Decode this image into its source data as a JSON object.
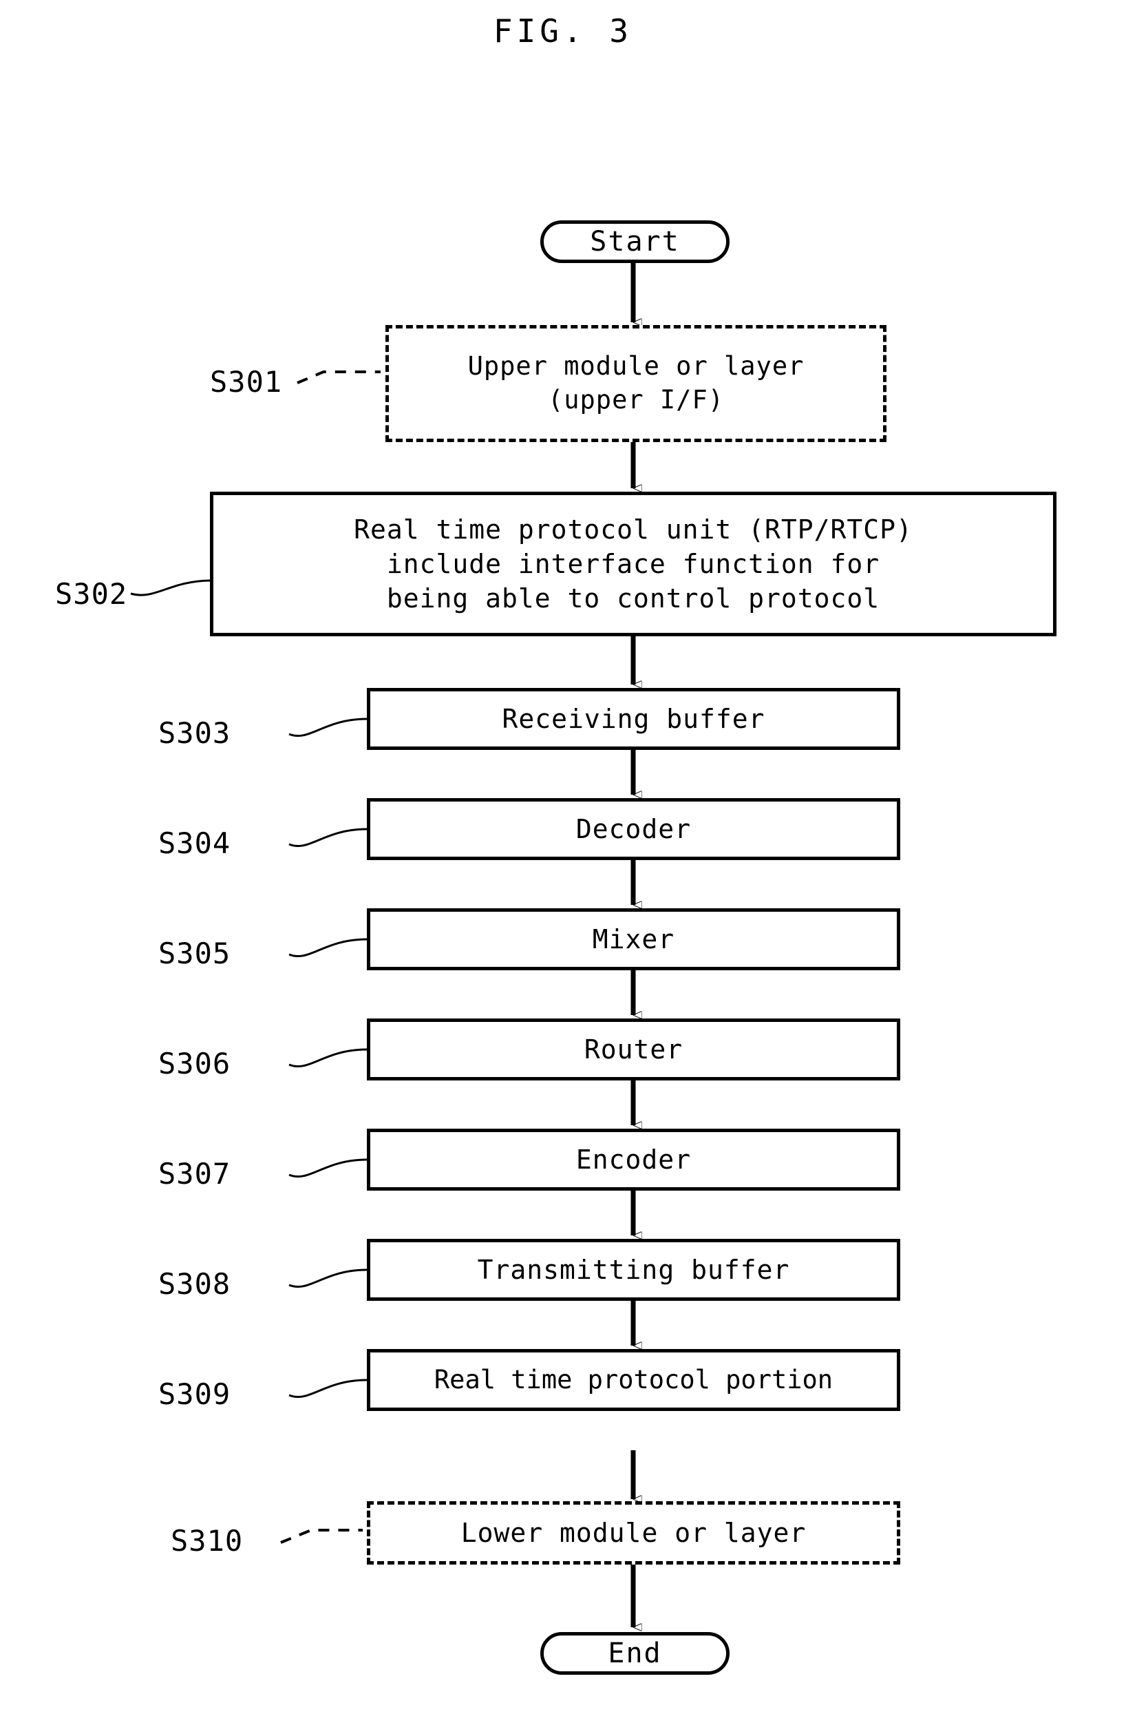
{
  "figure": {
    "title": "FIG. 3",
    "type": "patent-flowchart",
    "ink_color": "#000000",
    "background_color": "#ffffff"
  },
  "terminals": {
    "start": "Start",
    "end": "End"
  },
  "steps": [
    {
      "ref": "S301",
      "style": "dashed",
      "leader": "dashed",
      "lines": [
        "Upper module or layer",
        "(upper I/F)"
      ]
    },
    {
      "ref": "S302",
      "style": "solid",
      "leader": "curved",
      "lines": [
        "Real time protocol unit (RTP/RTCP)",
        "include interface function for",
        "being able to control protocol"
      ]
    },
    {
      "ref": "S303",
      "style": "solid",
      "leader": "curved",
      "lines": [
        "Receiving buffer"
      ]
    },
    {
      "ref": "S304",
      "style": "solid",
      "leader": "curved",
      "lines": [
        "Decoder"
      ]
    },
    {
      "ref": "S305",
      "style": "solid",
      "leader": "curved",
      "lines": [
        "Mixer"
      ]
    },
    {
      "ref": "S306",
      "style": "solid",
      "leader": "curved",
      "lines": [
        "Router"
      ]
    },
    {
      "ref": "S307",
      "style": "solid",
      "leader": "curved",
      "lines": [
        "Encoder"
      ]
    },
    {
      "ref": "S308",
      "style": "solid",
      "leader": "curved",
      "lines": [
        "Transmitting buffer"
      ]
    },
    {
      "ref": "S309",
      "style": "solid",
      "leader": "curved",
      "lines": [
        "Real time protocol portion"
      ]
    },
    {
      "ref": "S310",
      "style": "dashed",
      "leader": "dashed",
      "lines": [
        "Lower module or layer"
      ]
    }
  ]
}
